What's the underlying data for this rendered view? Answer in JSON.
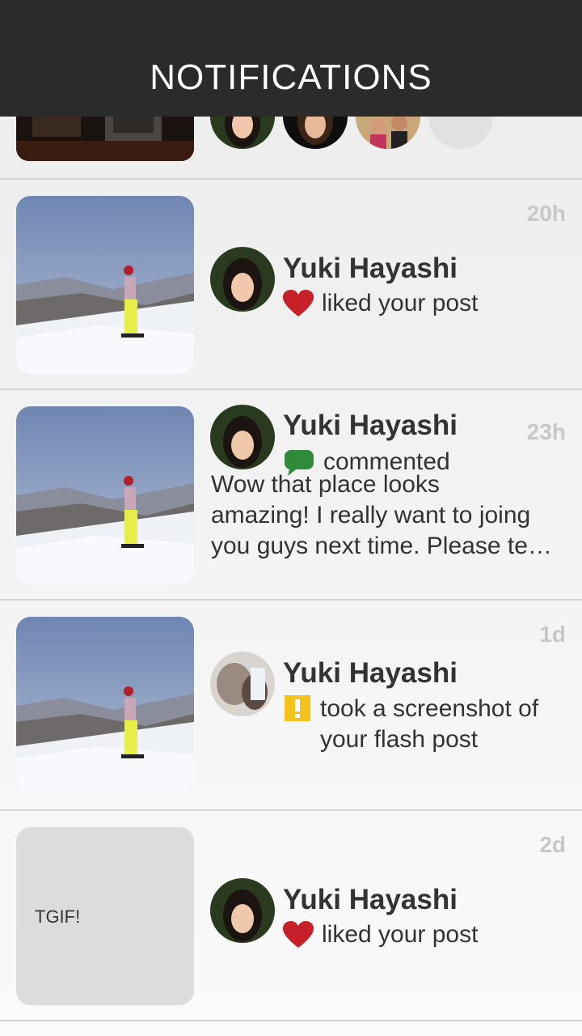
{
  "header": {
    "title": "NOTIFICATIONS",
    "background": "#2b2b2b"
  },
  "top_strip": {
    "more_label": "•••"
  },
  "notifications": [
    {
      "user": "Yuki Hayashi",
      "action": "liked your post",
      "action_icon": "heart-icon",
      "time": "20h",
      "thumbnail": "snowboard-photo"
    },
    {
      "user": "Yuki Hayashi",
      "action": "commented",
      "action_icon": "comment-bubble-icon",
      "time": "23h",
      "comment_lines": [
        "Wow that place looks",
        "amazing! I really want to joing",
        "you guys next time. Please te…"
      ],
      "thumbnail": "snowboard-photo"
    },
    {
      "user": "Yuki Hayashi",
      "action_lines": [
        "took a screenshot of",
        "your flash post"
      ],
      "action_icon": "warning-icon",
      "time": "1d",
      "thumbnail": "snowboard-photo"
    },
    {
      "user": "Yuki Hayashi",
      "action": "liked your post",
      "action_icon": "heart-icon",
      "time": "2d",
      "thumbnail_text": "TGIF!"
    }
  ],
  "colors": {
    "heart": "#c62128",
    "comment": "#2e8b3a",
    "warning": "#f3c21b",
    "timestamp": "#c8c8c8"
  }
}
